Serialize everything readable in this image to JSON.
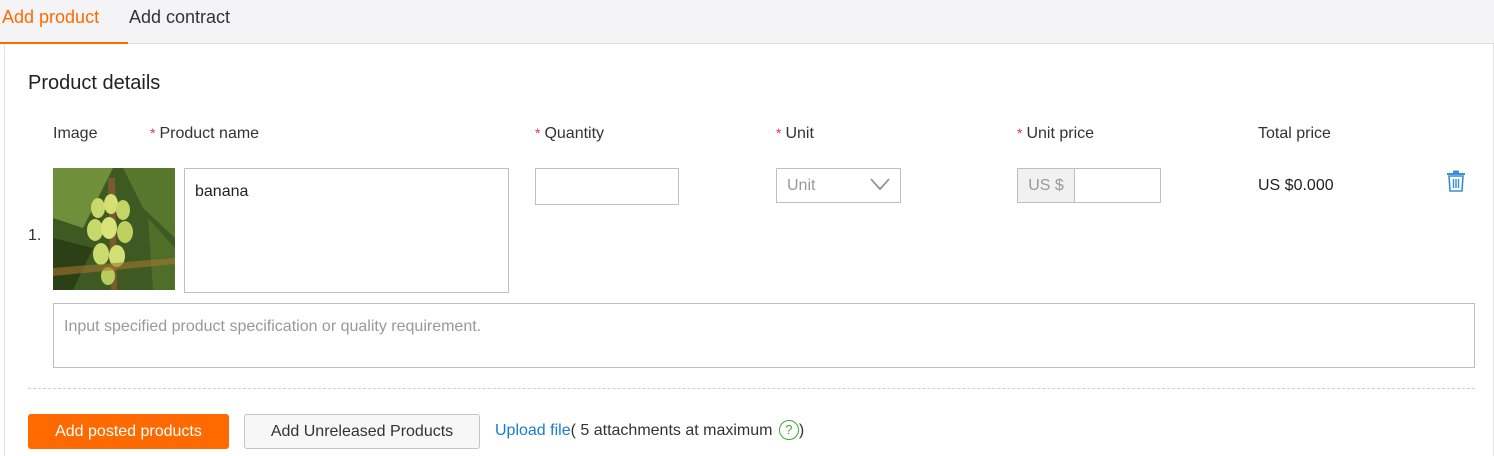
{
  "tabs": [
    {
      "label": "Add product",
      "active": true
    },
    {
      "label": "Add contract",
      "active": false
    }
  ],
  "section": {
    "title": "Product details"
  },
  "columns": {
    "image": "Image",
    "product_name": "Product name",
    "quantity": "Quantity",
    "unit": "Unit",
    "unit_price": "Unit price",
    "total_price": "Total price",
    "required_mark": "*"
  },
  "row": {
    "number": "1.",
    "product_name": "banana",
    "quantity": "",
    "unit_placeholder": "Unit",
    "price_prefix": "US $",
    "unit_price": "",
    "total": "US $0.000",
    "image_icon": "banana-photo"
  },
  "spec": {
    "placeholder": "Input specified product specification or quality requirement."
  },
  "actions": {
    "add_posted": "Add posted products",
    "add_unreleased": "Add Unreleased Products",
    "upload_link": "Upload file",
    "upload_note": "( 5 attachments at maximum",
    "upload_note_close": ")",
    "help_glyph": "?"
  },
  "colors": {
    "accent": "#ff6a00",
    "link": "#1a7bd1",
    "required": "#e4393c",
    "help": "#3aa83a"
  }
}
